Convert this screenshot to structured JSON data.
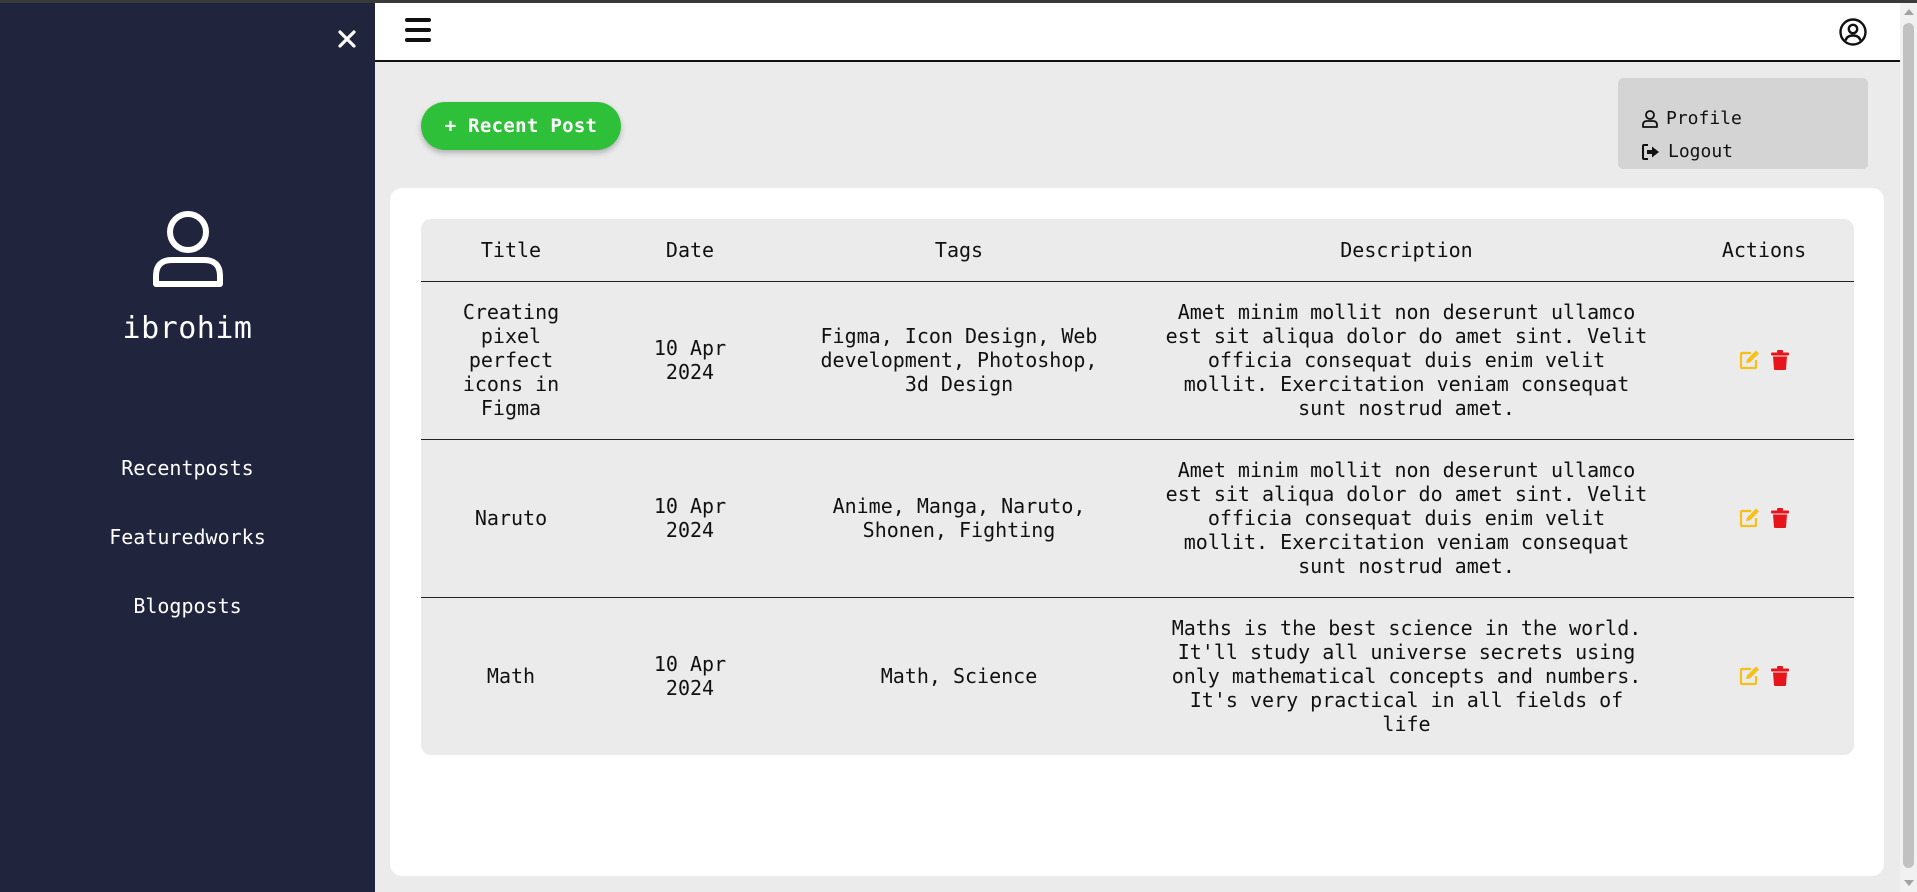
{
  "sidebar": {
    "username": "ibrohim",
    "nav": [
      "Recentposts",
      "Featuredworks",
      "Blogposts"
    ]
  },
  "toolbar": {
    "recent_post_label": "+ Recent Post"
  },
  "dropdown": {
    "profile_label": "Profile",
    "logout_label": "Logout"
  },
  "table": {
    "headers": [
      "Title",
      "Date",
      "Tags",
      "Description",
      "Actions"
    ],
    "rows": [
      {
        "title": "Creating pixel perfect icons in Figma",
        "date": "10 Apr 2024",
        "tags": "Figma, Icon Design, Web development, Photoshop, 3d Design",
        "description": "Amet minim mollit non deserunt ullamco est sit aliqua dolor do amet sint. Velit officia consequat duis enim velit mollit. Exercitation veniam consequat sunt nostrud amet."
      },
      {
        "title": "Naruto",
        "date": "10 Apr 2024",
        "tags": "Anime, Manga, Naruto, Shonen, Fighting",
        "description": "Amet minim mollit non deserunt ullamco est sit aliqua dolor do amet sint. Velit officia consequat duis enim velit mollit. Exercitation veniam consequat sunt nostrud amet."
      },
      {
        "title": "Math",
        "date": "10 Apr 2024",
        "tags": "Math, Science",
        "description": "Maths is the best science in the world. It'll study all universe secrets using only mathematical concepts and numbers. It's very practical in all fields of life"
      }
    ]
  },
  "icons": {
    "close": "close-icon",
    "hamburger": "hamburger-icon",
    "user_circle": "user-circle-icon",
    "avatar": "user-icon",
    "profile": "person-icon",
    "logout": "logout-icon",
    "edit": "edit-icon",
    "delete": "trash-icon"
  },
  "colors": {
    "sidebar_bg": "#20243d",
    "accent_green": "#2fc03a",
    "edit_yellow": "#f6c01b",
    "delete_red": "#e8141c"
  }
}
